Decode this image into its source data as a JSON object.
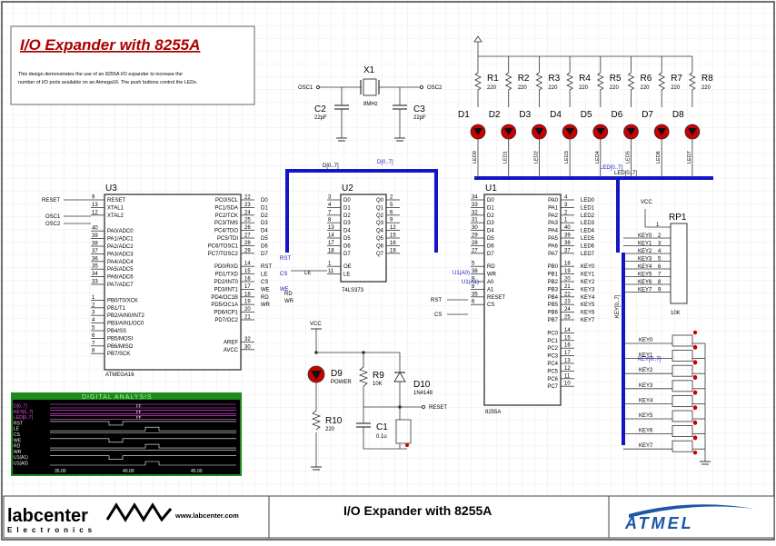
{
  "title_box": {
    "title": "I/O Expander with 8255A",
    "description_line1": "This design demonstrates the use of an 8255A I/O expander to increase the",
    "description_line2": "number of I/O ports available on an Atmega16. The push buttons control the LEDs."
  },
  "crystal": {
    "ref": "X1",
    "value": "8MHz",
    "osc1": "OSC1",
    "osc2": "OSC2"
  },
  "caps": [
    {
      "ref": "C2",
      "value": "22pF"
    },
    {
      "ref": "C3",
      "value": "22pF"
    },
    {
      "ref": "C1",
      "value": "0.1u"
    }
  ],
  "resistors": [
    {
      "ref": "R1",
      "value": "220"
    },
    {
      "ref": "R2",
      "value": "220"
    },
    {
      "ref": "R3",
      "value": "220"
    },
    {
      "ref": "R4",
      "value": "220"
    },
    {
      "ref": "R5",
      "value": "220"
    },
    {
      "ref": "R6",
      "value": "220"
    },
    {
      "ref": "R7",
      "value": "220"
    },
    {
      "ref": "R8",
      "value": "220"
    }
  ],
  "leds": [
    {
      "ref": "D1",
      "net": "LED0"
    },
    {
      "ref": "D2",
      "net": "LED1"
    },
    {
      "ref": "D3",
      "net": "LED2"
    },
    {
      "ref": "D4",
      "net": "LED3"
    },
    {
      "ref": "D5",
      "net": "LED4"
    },
    {
      "ref": "D6",
      "net": "LED5"
    },
    {
      "ref": "D7",
      "net": "LED6"
    },
    {
      "ref": "D8",
      "net": "LED7"
    }
  ],
  "bus_labels": {
    "d_bus": "D[0..7]",
    "d_bus2": "D[0..7]",
    "led_bus": "LED[0..7]",
    "led_bus2": "LED[0..7]",
    "key_bus": "KEY[0..7]",
    "key_bus2": "KEY[0..7]"
  },
  "u3": {
    "ref": "U3",
    "part": "ATMEGA16",
    "left_pins": [
      {
        "num": "9",
        "name": "RESET",
        "net": "RESET"
      },
      {
        "num": "13",
        "name": "XTAL1",
        "net": "OSC1"
      },
      {
        "num": "12",
        "name": "XTAL2",
        "net": "OSC2"
      },
      {
        "num": "40",
        "name": "PA0/ADC0"
      },
      {
        "num": "39",
        "name": "PA1/ADC1"
      },
      {
        "num": "38",
        "name": "PA2/ADC2"
      },
      {
        "num": "37",
        "name": "PA3/ADC3"
      },
      {
        "num": "36",
        "name": "PA4/ADC4"
      },
      {
        "num": "35",
        "name": "PA5/ADC5"
      },
      {
        "num": "34",
        "name": "PA6/ADC6"
      },
      {
        "num": "33",
        "name": "PA7/ADC7"
      },
      {
        "num": "1",
        "name": "PB0/T0/XCK"
      },
      {
        "num": "2",
        "name": "PB1/T1"
      },
      {
        "num": "3",
        "name": "PB2/AIN0/INT2"
      },
      {
        "num": "4",
        "name": "PB3/AIN1/OC0"
      },
      {
        "num": "5",
        "name": "PB4/SS"
      },
      {
        "num": "6",
        "name": "PB5/MOSI"
      },
      {
        "num": "7",
        "name": "PB6/MISO"
      },
      {
        "num": "8",
        "name": "PB7/SCK"
      }
    ],
    "right_pins": [
      {
        "num": "22",
        "name": "PC0/SCL",
        "net": "D0"
      },
      {
        "num": "23",
        "name": "PC1/SDA",
        "net": "D1"
      },
      {
        "num": "24",
        "name": "PC2/TCK",
        "net": "D2"
      },
      {
        "num": "25",
        "name": "PC3/TMS",
        "net": "D3"
      },
      {
        "num": "26",
        "name": "PC4/TDO",
        "net": "D4"
      },
      {
        "num": "27",
        "name": "PC5/TDI",
        "net": "D5"
      },
      {
        "num": "28",
        "name": "PC6/TOSC1",
        "net": "D6"
      },
      {
        "num": "29",
        "name": "PC7/TOSC2",
        "net": "D7"
      },
      {
        "num": "14",
        "name": "PD0/RXD",
        "net": "RST"
      },
      {
        "num": "15",
        "name": "PD1/TXD",
        "net": "LE"
      },
      {
        "num": "16",
        "name": "PD2/INT0",
        "net": "CS"
      },
      {
        "num": "17",
        "name": "PD3/INT1",
        "net": "WE"
      },
      {
        "num": "18",
        "name": "PD4/OC1B",
        "net": "RD"
      },
      {
        "num": "19",
        "name": "PD5/OC1A",
        "net": "WR"
      },
      {
        "num": "20",
        "name": "PD6/ICP1"
      },
      {
        "num": "21",
        "name": "PD7/OC2"
      },
      {
        "num": "32",
        "name": "AREF"
      },
      {
        "num": "30",
        "name": "AVCC"
      }
    ]
  },
  "u2": {
    "ref": "U2",
    "part": "74LS373",
    "left_pins": [
      {
        "num": "3",
        "name": "D0",
        "net": "D0"
      },
      {
        "num": "4",
        "name": "D1",
        "net": "D1"
      },
      {
        "num": "7",
        "name": "D2",
        "net": "D2"
      },
      {
        "num": "8",
        "name": "D3",
        "net": "D3"
      },
      {
        "num": "13",
        "name": "D4",
        "net": "D4"
      },
      {
        "num": "14",
        "name": "D5",
        "net": "D5"
      },
      {
        "num": "17",
        "name": "D6",
        "net": "D6"
      },
      {
        "num": "18",
        "name": "D7",
        "net": "D7"
      },
      {
        "num": "1",
        "name": "OE"
      },
      {
        "num": "11",
        "name": "LE",
        "net": "LE"
      }
    ],
    "right_pins": [
      {
        "num": "2",
        "name": "Q0"
      },
      {
        "num": "5",
        "name": "Q1"
      },
      {
        "num": "6",
        "name": "Q2"
      },
      {
        "num": "9",
        "name": "Q3"
      },
      {
        "num": "12",
        "name": "Q4"
      },
      {
        "num": "15",
        "name": "Q5"
      },
      {
        "num": "16",
        "name": "Q6"
      },
      {
        "num": "19",
        "name": "Q7"
      }
    ]
  },
  "u1": {
    "ref": "U1",
    "part": "8255A",
    "left_pins": [
      {
        "num": "34",
        "name": "D0",
        "net": "D0"
      },
      {
        "num": "33",
        "name": "D1",
        "net": "D1"
      },
      {
        "num": "32",
        "name": "D2",
        "net": "D2"
      },
      {
        "num": "31",
        "name": "D3",
        "net": "D3"
      },
      {
        "num": "30",
        "name": "D4",
        "net": "D4"
      },
      {
        "num": "29",
        "name": "D5",
        "net": "D5"
      },
      {
        "num": "28",
        "name": "D6",
        "net": "D6"
      },
      {
        "num": "27",
        "name": "D7",
        "net": "D7"
      },
      {
        "num": "5",
        "name": "RD",
        "net": "RD"
      },
      {
        "num": "36",
        "name": "WR",
        "net": "WR"
      },
      {
        "num": "9",
        "name": "A0",
        "net": "U1(A0)"
      },
      {
        "num": "8",
        "name": "A1",
        "net": "U1(A1)"
      },
      {
        "num": "35",
        "name": "RESET",
        "net": "RST"
      },
      {
        "num": "6",
        "name": "CS",
        "net": "CS"
      }
    ],
    "right_pins": [
      {
        "num": "4",
        "name": "PA0",
        "net": "LED0"
      },
      {
        "num": "3",
        "name": "PA1",
        "net": "LED1"
      },
      {
        "num": "2",
        "name": "PA2",
        "net": "LED2"
      },
      {
        "num": "1",
        "name": "PA3",
        "net": "LED3"
      },
      {
        "num": "40",
        "name": "PA4",
        "net": "LED4"
      },
      {
        "num": "39",
        "name": "PA5",
        "net": "LED5"
      },
      {
        "num": "38",
        "name": "PA6",
        "net": "LED6"
      },
      {
        "num": "37",
        "name": "PA7",
        "net": "LED7"
      },
      {
        "num": "18",
        "name": "PB0",
        "net": "KEY0"
      },
      {
        "num": "19",
        "name": "PB1",
        "net": "KEY1"
      },
      {
        "num": "20",
        "name": "PB2",
        "net": "KEY2"
      },
      {
        "num": "21",
        "name": "PB3",
        "net": "KEY3"
      },
      {
        "num": "22",
        "name": "PB4",
        "net": "KEY4"
      },
      {
        "num": "23",
        "name": "PB5",
        "net": "KEY5"
      },
      {
        "num": "24",
        "name": "PB6",
        "net": "KEY6"
      },
      {
        "num": "25",
        "name": "PB7",
        "net": "KEY7"
      },
      {
        "num": "14",
        "name": "PC0"
      },
      {
        "num": "15",
        "name": "PC1"
      },
      {
        "num": "16",
        "name": "PC2"
      },
      {
        "num": "17",
        "name": "PC3"
      },
      {
        "num": "13",
        "name": "PC4"
      },
      {
        "num": "12",
        "name": "PC5"
      },
      {
        "num": "11",
        "name": "PC6"
      },
      {
        "num": "10",
        "name": "PC7"
      }
    ]
  },
  "rp1": {
    "ref": "RP1",
    "value": "10K",
    "vcc": "VCC",
    "pins": [
      "2",
      "3",
      "4",
      "5",
      "6",
      "7",
      "8",
      "9"
    ],
    "keys": [
      "KEY0",
      "KEY1",
      "KEY2",
      "KEY3",
      "KEY4",
      "KEY5",
      "KEY6",
      "KEY7"
    ]
  },
  "buttons": [
    "KEY0",
    "KEY1",
    "KEY2",
    "KEY3",
    "KEY4",
    "KEY5",
    "KEY6",
    "KEY7"
  ],
  "reset_circuit": {
    "vcc": "VCC",
    "d9": "D9",
    "d9_label": "POWER",
    "r9": "R9",
    "r9_value": "10K",
    "d10": "D10",
    "d10_value": "1N4148",
    "r10": "R10",
    "r10_value": "220",
    "reset_net": "RESET"
  },
  "net_labels": {
    "reset": "RESET",
    "osc1": "OSC1",
    "osc2": "OSC2",
    "rst": "RST",
    "le": "LE",
    "cs": "CS",
    "we": "WE",
    "rd": "RD",
    "wr": "WR",
    "u1a0": "U1(A0)",
    "u1a1": "U1(A1)"
  },
  "digital_analysis": {
    "title": "DIGITAL ANALYSIS",
    "traces": [
      "D[0..7]",
      "KEY[0..7]",
      "LED[0..7]",
      "RST",
      "LE",
      "CS",
      "WE",
      "RD",
      "WR",
      "U1(A1)",
      "U1(A0)"
    ],
    "bus_values": [
      "FF",
      "FF",
      "FF",
      "FF"
    ],
    "time_labels": [
      "35.00",
      "40.00",
      "45.00"
    ]
  },
  "footer": {
    "logo": "labcenter",
    "logo_sub": "Electronics",
    "url": "www.labcenter.com",
    "title": "I/O Expander with 8255A",
    "brand": "ATMEL"
  },
  "colors": {
    "bus": "#1414c8",
    "wire": "#333333",
    "title_red": "#aa0000",
    "grid": "#d8d8d8",
    "led_red": "#cc0000"
  }
}
